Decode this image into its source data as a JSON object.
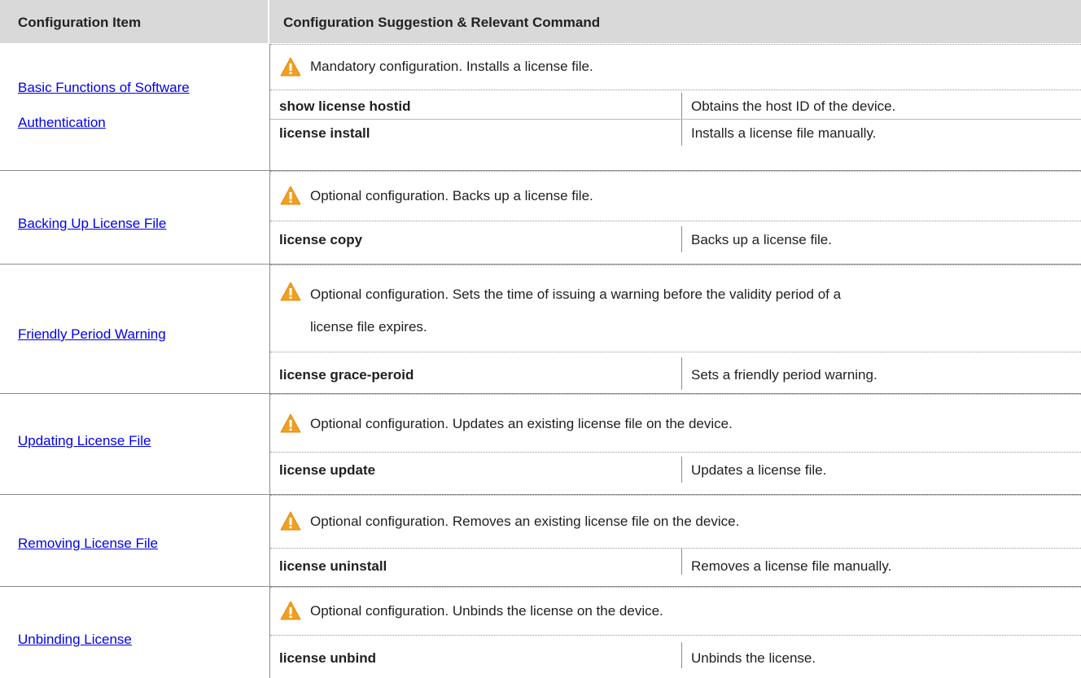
{
  "header": {
    "col_item": "Configuration Item",
    "col_suggestion": "Configuration Suggestion & Relevant Command"
  },
  "icons": {
    "warning": "warning-triangle-icon",
    "warning_color": "#f0a020"
  },
  "link_color": "#0000ee",
  "header_bg": "#d9d9d9",
  "sections": [
    {
      "item": [
        "Basic Functions of Software",
        "Authentication"
      ],
      "suggestion": [
        "Mandatory configuration. Installs a license file."
      ],
      "commands": [
        {
          "command": "show license hostid",
          "description": "Obtains the host ID of the device."
        },
        {
          "command": "license install",
          "description": "Installs a license file manually."
        }
      ]
    },
    {
      "item": [
        "Backing Up License File"
      ],
      "suggestion": [
        "Optional configuration. Backs up a license file."
      ],
      "commands": [
        {
          "command": "license copy",
          "description": "Backs up a license file."
        }
      ]
    },
    {
      "item": [
        "Friendly Period Warning"
      ],
      "suggestion": [
        "Optional configuration. Sets the time of issuing a warning before the validity period of a",
        "license file expires."
      ],
      "commands": [
        {
          "command": "license grace-peroid",
          "description": "Sets a friendly period warning."
        }
      ]
    },
    {
      "item": [
        "Updating License File"
      ],
      "suggestion": [
        "Optional configuration. Updates an existing license file on the device."
      ],
      "commands": [
        {
          "command": "license update",
          "description": "Updates a license file."
        }
      ]
    },
    {
      "item": [
        "Removing License File"
      ],
      "suggestion": [
        "Optional configuration. Removes an existing license file on the device."
      ],
      "commands": [
        {
          "command": "license uninstall",
          "description": "Removes a license file manually."
        }
      ]
    },
    {
      "item": [
        "Unbinding License"
      ],
      "suggestion": [
        "Optional configuration. Unbinds the license on the device."
      ],
      "commands": [
        {
          "command": "license unbind",
          "description": "Unbinds the license."
        }
      ]
    }
  ]
}
